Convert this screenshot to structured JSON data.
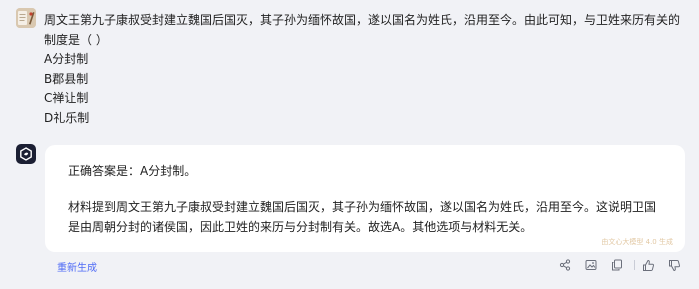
{
  "question": {
    "lines": [
      "周文王第九子康叔受封建立魏国后国灭，其子孙为缅怀故国，遂以国名为姓氏，沿用至今。由此可知，与卫姓来历有关的",
      "制度是（ ）",
      "A分封制",
      "B郡县制",
      "C禅让制",
      "D礼乐制"
    ]
  },
  "answer": {
    "correct": "正确答案是：A分封制。",
    "explanation_lines": [
      "材料提到周文王第九子康叔受封建立魏国后国灭，其子孙为缅怀故国，遂以国名为姓氏，沿用至今。这说明卫国",
      "是由周朝分封的诸侯国，因此卫姓的来历与分封制有关。故选A。其他选项与材料无关。"
    ],
    "watermark": "由文心大模型 4.0 生成"
  },
  "actions": {
    "regenerate_label": "重新生成",
    "icons": [
      "share-icon",
      "image-icon",
      "copy-icon",
      "thumbs-up-icon",
      "thumbs-down-icon"
    ]
  },
  "colors": {
    "background": "#f1f2f6",
    "card": "#ffffff",
    "link": "#4f6bf5",
    "bot_avatar": "#1b1f33"
  }
}
